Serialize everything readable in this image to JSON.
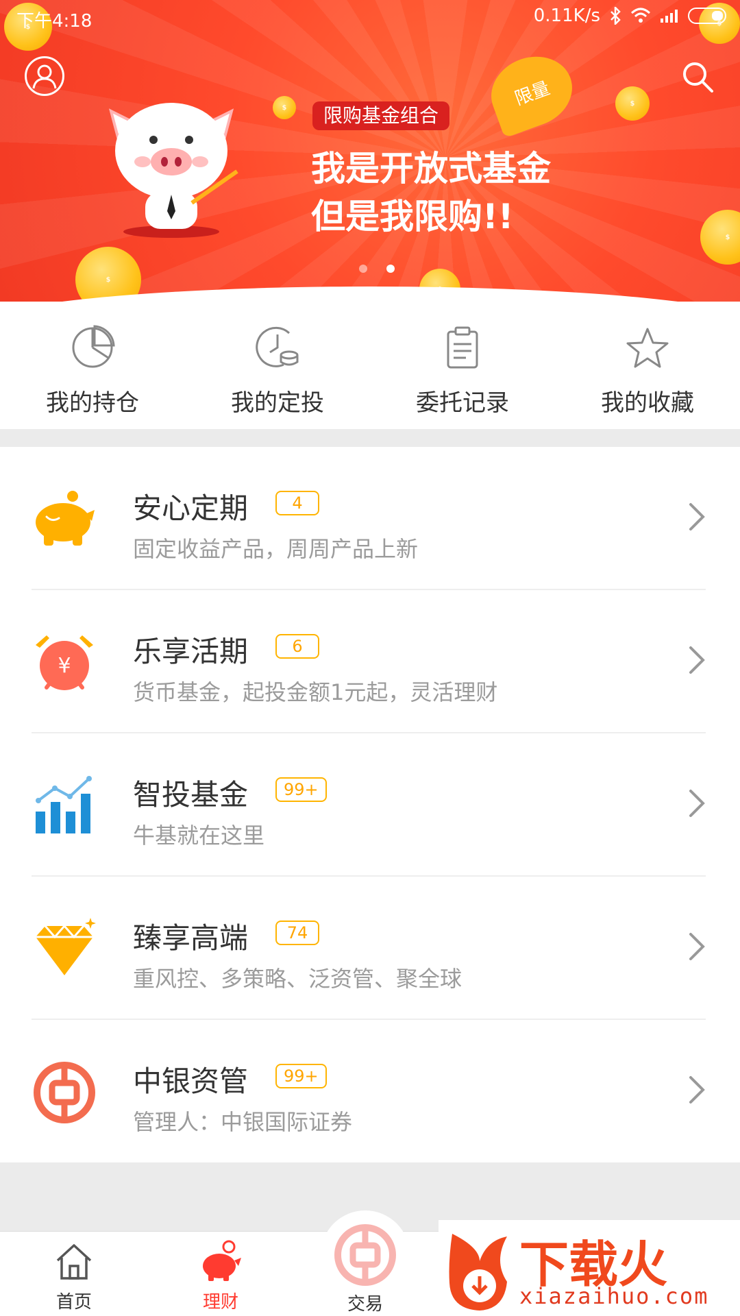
{
  "status": {
    "time": "下午4:18",
    "speed": "0.11K/s"
  },
  "banner": {
    "tag": "限购基金组合",
    "limited": "限量",
    "line1": "我是开放式基金",
    "line2": "但是我限购!!",
    "pages": 2,
    "active_page": 2
  },
  "quick_nav": [
    {
      "label": "我的持仓",
      "icon": "pie-chart-icon"
    },
    {
      "label": "我的定投",
      "icon": "clock-coins-icon"
    },
    {
      "label": "委托记录",
      "icon": "clipboard-icon"
    },
    {
      "label": "我的收藏",
      "icon": "star-icon"
    }
  ],
  "products": [
    {
      "title": "安心定期",
      "badge": "4",
      "subtitle": "固定收益产品，周周产品上新",
      "icon": "piggy-bank-icon"
    },
    {
      "title": "乐享活期",
      "badge": "6",
      "subtitle": "货币基金，起投金额1元起，灵活理财",
      "icon": "alarm-clock-yen-icon"
    },
    {
      "title": "智投基金",
      "badge": "99+",
      "subtitle": "牛基就在这里",
      "icon": "bar-trend-icon"
    },
    {
      "title": "臻享高端",
      "badge": "74",
      "subtitle": "重风控、多策略、泛资管、聚全球",
      "icon": "diamond-icon"
    },
    {
      "title": "中银资管",
      "badge": "99+",
      "subtitle": "管理人：中银国际证券",
      "icon": "boc-logo-icon"
    }
  ],
  "tabs": [
    {
      "label": "首页",
      "icon": "home-icon"
    },
    {
      "label": "理财",
      "icon": "piggy-icon"
    },
    {
      "label": "交易",
      "icon": "boc-icon"
    }
  ],
  "watermark": {
    "brand": "下载火",
    "url": "xiazaihuo.com"
  },
  "colors": {
    "accent": "#ff3b30",
    "badge": "#ffb400",
    "banner": "#f23a24"
  }
}
